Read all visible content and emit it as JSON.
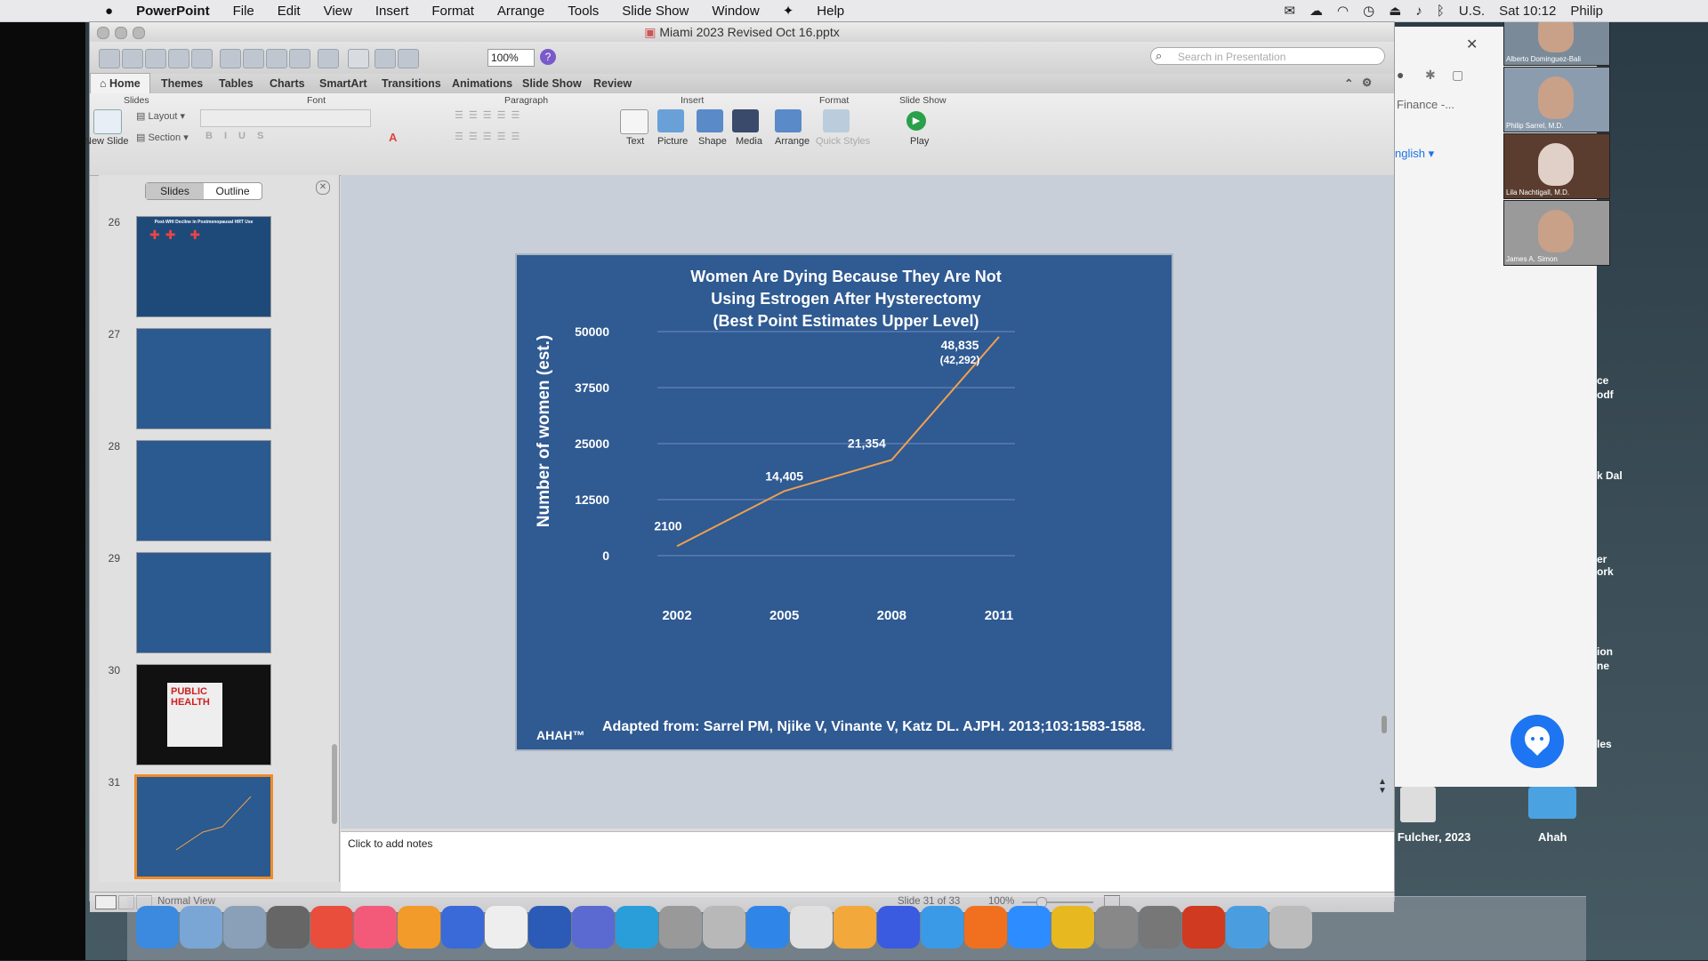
{
  "menubar": {
    "apple": "",
    "app": "PowerPoint",
    "items": [
      "File",
      "Edit",
      "View",
      "Insert",
      "Format",
      "Arrange",
      "Tools",
      "Slide Show",
      "Window",
      "Help"
    ],
    "locale": "U.S.",
    "clock": "Sat 10:12",
    "user": "Philip"
  },
  "window": {
    "title": "Miami 2023 Revised Oct 16.pptx",
    "zoom": "100%",
    "search_placeholder": "Search in Presentation"
  },
  "ribbon_tabs": [
    "Home",
    "Themes",
    "Tables",
    "Charts",
    "SmartArt",
    "Transitions",
    "Animations",
    "Slide Show",
    "Review"
  ],
  "ribbon": {
    "groups": {
      "slides": "Slides",
      "font": "Font",
      "paragraph": "Paragraph",
      "insert": "Insert",
      "format": "Format",
      "slideshow": "Slide Show"
    },
    "new_slide": "New Slide",
    "layout": "Layout",
    "section": "Section",
    "insert_buttons": [
      "Text",
      "Picture",
      "Shape",
      "Media"
    ],
    "format_buttons": [
      "Arrange",
      "Quick Styles"
    ],
    "play": "Play"
  },
  "slides_pane": {
    "tab_slides": "Slides",
    "tab_outline": "Outline",
    "thumbnails": [
      {
        "num": "26",
        "title": "Post-WHI Decline in Postmenopausal HRT Use"
      },
      {
        "num": "27",
        "title": ""
      },
      {
        "num": "28",
        "title": ""
      },
      {
        "num": "29",
        "title": ""
      },
      {
        "num": "30",
        "title": "PUBLIC HEALTH"
      },
      {
        "num": "31",
        "title": ""
      }
    ]
  },
  "slide": {
    "title_lines": [
      "Women Are Dying Because They Are Not",
      "Using Estrogen After Hysterectomy",
      "(Best Point Estimates Upper Level)"
    ],
    "footer_brand": "AHAH™",
    "citation": "Adapted from: Sarrel PM, Njike V, Vinante V, Katz DL. AJPH. 2013;103:1583-1588."
  },
  "chart_data": {
    "type": "line",
    "title": "Women Are Dying Because They Are Not Using Estrogen After Hysterectomy (Best Point Estimates Upper Level)",
    "xlabel": "",
    "ylabel": "Number of women (est.)",
    "categories": [
      "2002",
      "2005",
      "2008",
      "2011"
    ],
    "yticks": [
      "50000",
      "37500",
      "25000",
      "12500",
      "0"
    ],
    "ylim": [
      0,
      50000
    ],
    "series": [
      {
        "values": [
          2100,
          14405,
          21354,
          48835
        ],
        "color": "#f0a050"
      }
    ],
    "data_labels": [
      "2100",
      "14,405",
      "21,354",
      "48,835"
    ],
    "extra_label": "(42,292)",
    "grid": true
  },
  "notes": {
    "placeholder": "Click to add notes"
  },
  "statusbar": {
    "view": "Normal View",
    "slide_info": "Slide 31 of 33",
    "zoom": "100%"
  },
  "browser": {
    "label1": "Finance -...",
    "label2": "nglish"
  },
  "desktop": {
    "icon1": "a Fulcher, 2023",
    "icon2": "Ahah",
    "side_texts": [
      "ce",
      "odf",
      "k Dal",
      "er",
      "ork",
      "ion",
      "ne",
      "les"
    ]
  },
  "zoom_tiles": [
    {
      "name": "Alberto Dominguez-Bali"
    },
    {
      "name": "Philip Sarrel, M.D."
    },
    {
      "name": "Lila Nachtigall, M.D."
    },
    {
      "name": "James A. Simon"
    }
  ],
  "dock": [
    "Finder",
    "Preview",
    "Photos",
    "System Preferences",
    "Chrome",
    "iTunes",
    "Books",
    "Pages",
    "TextEdit",
    "Word",
    "Teams",
    "C",
    "Calculator",
    "Image Capture",
    "Safari",
    "Preview2",
    "Photos2",
    "Messenger",
    "Messages",
    "Firefox",
    "Zoom",
    "O",
    "Utilities",
    "Keychain",
    "PowerPoint",
    "Folder",
    "Trash"
  ],
  "colors": {
    "slide_bg": "#2f5a92",
    "line": "#f0a050",
    "thumb_highlight": "#f18b25",
    "zoom_chat": "#1d75f2"
  }
}
